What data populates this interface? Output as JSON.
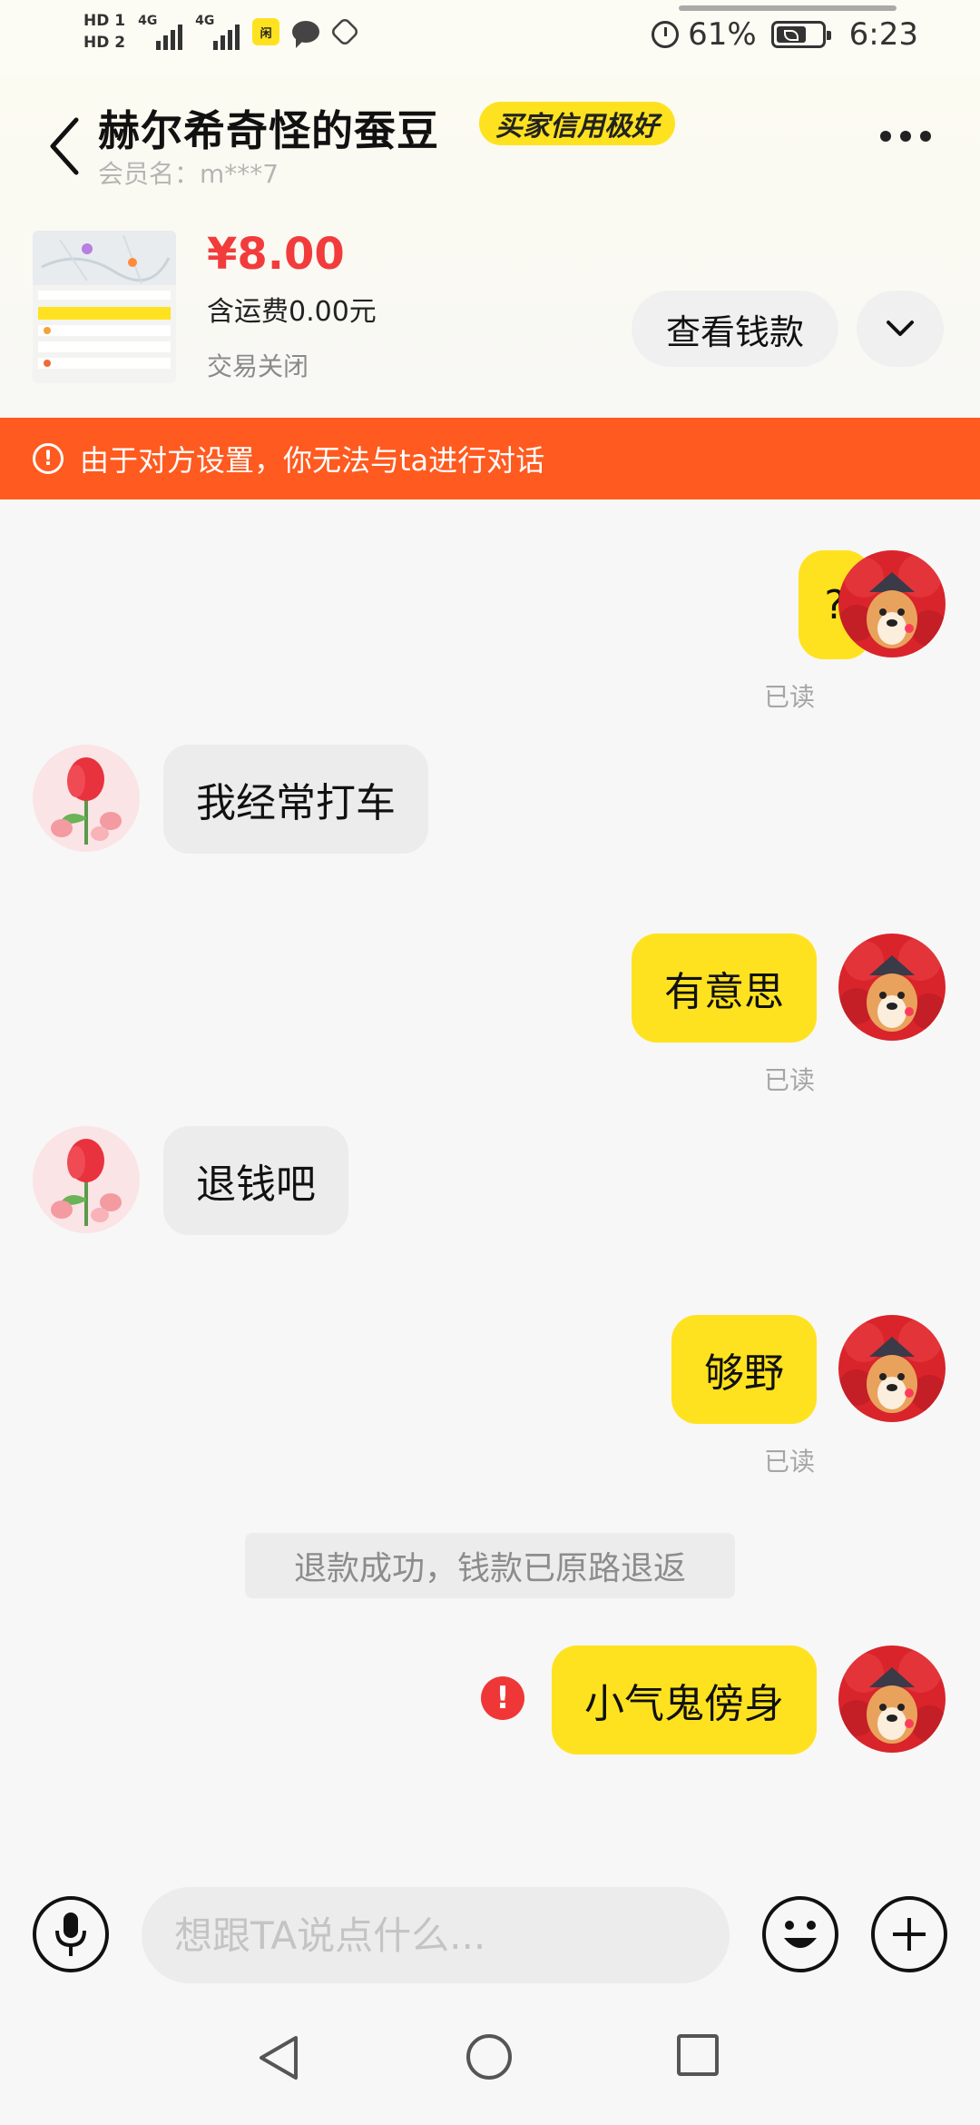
{
  "status_bar": {
    "hd1": "HD 1",
    "hd2": "HD 2",
    "net1": "4G",
    "net2": "4G",
    "battery_percent": "61%",
    "time": "6:23",
    "icons": [
      "signal-icon",
      "app-notification-icon",
      "message-icon",
      "shield-icon",
      "alarm-icon",
      "battery-icon"
    ]
  },
  "header": {
    "seller_name": "赫尔希奇怪的蚕豆",
    "credit_badge": "买家信用极好",
    "member_name": "会员名：m***7"
  },
  "product": {
    "price": "¥8.00",
    "shipping": "含运费0.00元",
    "status": "交易关闭",
    "view_button": "查看钱款"
  },
  "warning": {
    "text": "由于对方设置，你无法与ta进行对话",
    "color": "#ff5a1f"
  },
  "messages": [
    {
      "from": "me",
      "text": "?",
      "read": "已读"
    },
    {
      "from": "peer",
      "text": "我经常打车"
    },
    {
      "from": "me",
      "text": "有意思",
      "read": "已读"
    },
    {
      "from": "peer",
      "text": "退钱吧"
    },
    {
      "from": "me",
      "text": "够野",
      "read": "已读"
    },
    {
      "from": "system",
      "text": "退款成功，钱款已原路退返"
    },
    {
      "from": "me",
      "text": "小气鬼傍身",
      "failed": true,
      "fail_mark": "!"
    }
  ],
  "input": {
    "placeholder": "想跟TA说点什么..."
  },
  "colors": {
    "accent_yellow": "#ffe21f",
    "price_red": "#f23c3c",
    "banner_orange": "#ff5a1f"
  }
}
